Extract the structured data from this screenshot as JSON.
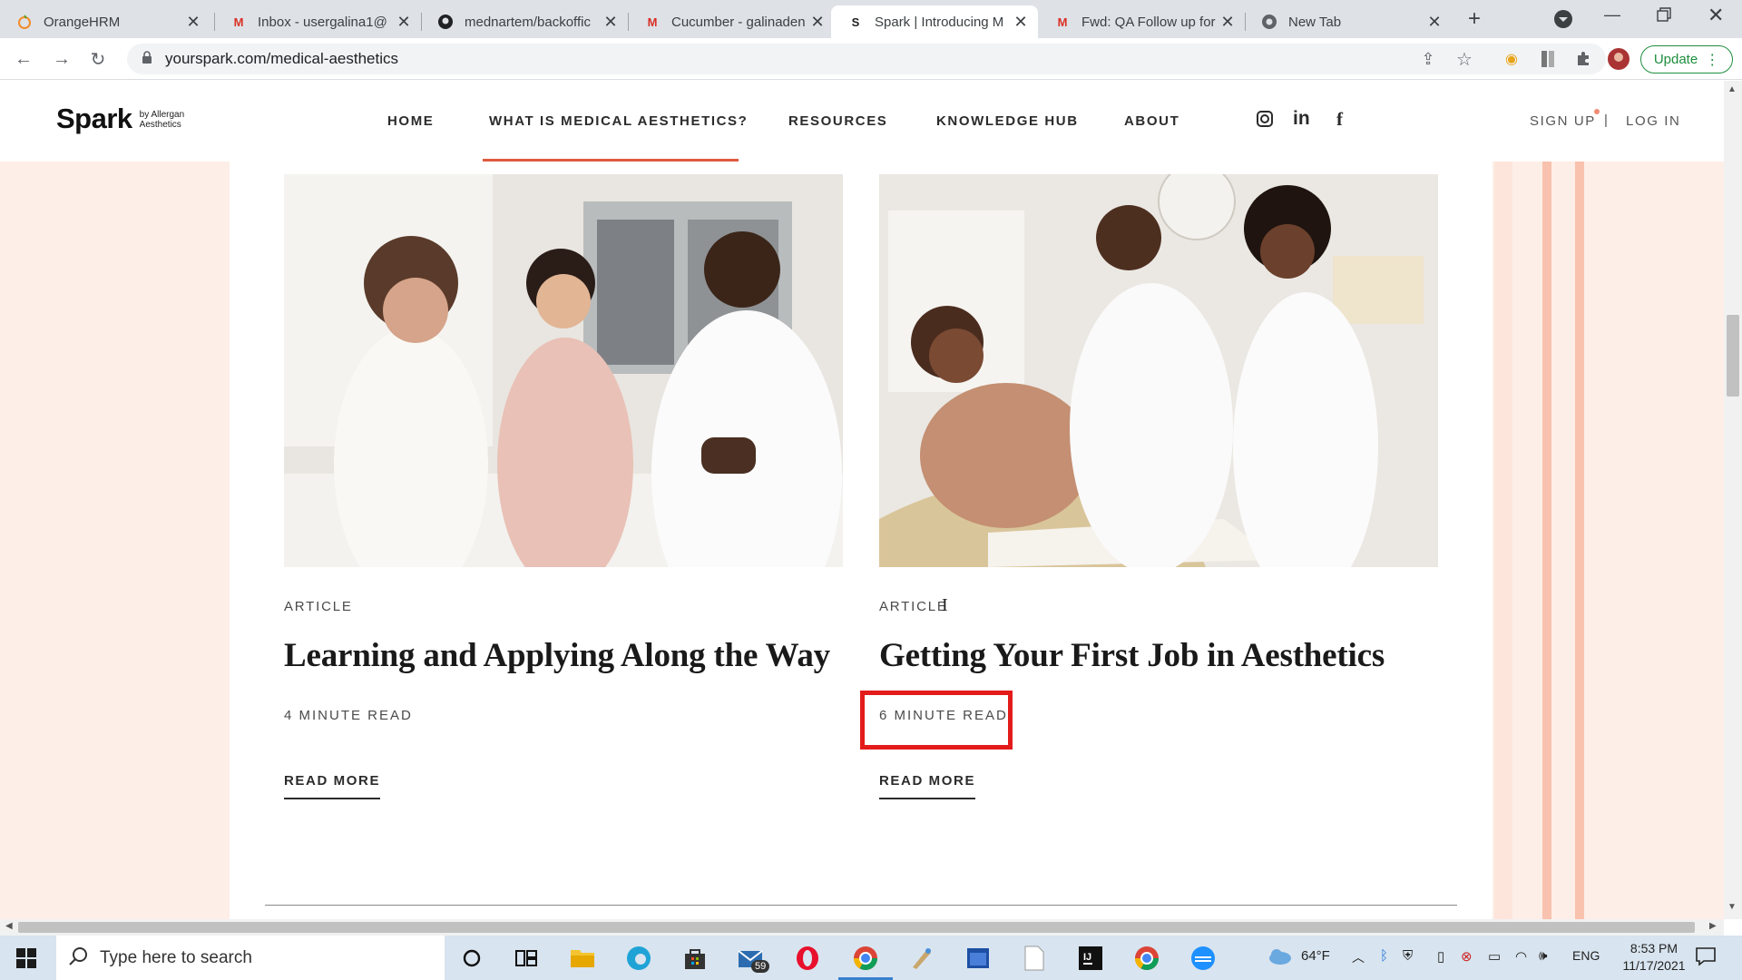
{
  "browser": {
    "tabs": [
      {
        "title": "OrangeHRM",
        "icon": "orangehrm-icon",
        "active": false
      },
      {
        "title": "Inbox - usergalina1@",
        "icon": "gmail-icon",
        "active": false
      },
      {
        "title": "mednartem/backoffic",
        "icon": "github-icon",
        "active": false
      },
      {
        "title": "Cucumber - galinaden",
        "icon": "gmail-icon",
        "active": false
      },
      {
        "title": "Spark | Introducing M",
        "icon": "spark-icon",
        "active": true
      },
      {
        "title": "Fwd: QA Follow up for",
        "icon": "gmail-icon",
        "active": false
      },
      {
        "title": "New Tab",
        "icon": "chrome-icon",
        "active": false
      }
    ],
    "url": "yourspark.com/medical-aesthetics",
    "update_label": "Update"
  },
  "site": {
    "logo": "Spark",
    "logo_sub1": "by Allergan",
    "logo_sub2": "Aesthetics",
    "nav": {
      "home": "HOME",
      "medical": "WHAT IS MEDICAL AESTHETICS?",
      "resources": "RESOURCES",
      "knowledge": "KNOWLEDGE HUB",
      "about": "ABOUT"
    },
    "signup": "SIGN UP",
    "divider": "|",
    "login": "LOG IN",
    "accent": "#e05a3f"
  },
  "articles": [
    {
      "kicker": "ARTICLE",
      "title": "Learning and Applying Along the Way",
      "read_time": "4 MINUTE READ",
      "cta": "READ MORE"
    },
    {
      "kicker": "ARTICLE",
      "title": "Getting Your First Job in Aesthetics",
      "read_time": "6 MINUTE READ",
      "cta": "READ MORE"
    }
  ],
  "highlight_color": "#e31b1b",
  "taskbar": {
    "search_placeholder": "Type here to search",
    "mail_badge": "59",
    "weather": "64°F",
    "language": "ENG",
    "time": "8:53 PM",
    "date": "11/17/2021"
  }
}
